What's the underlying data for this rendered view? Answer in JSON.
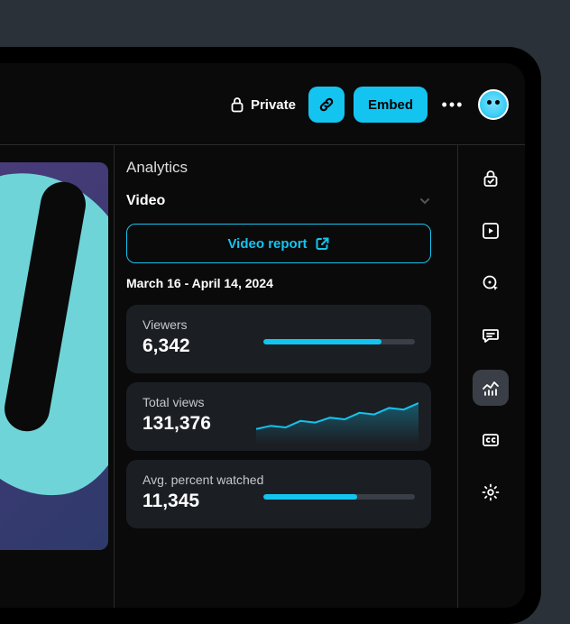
{
  "topbar": {
    "privacy_label": "Private",
    "embed_label": "Embed"
  },
  "analytics": {
    "title": "Analytics",
    "tab_label": "Video",
    "report_button": "Video report",
    "date_range": "March 16 - April 14, 2024",
    "cards": [
      {
        "label": "Viewers",
        "value": "6,342",
        "bar_pct": 78
      },
      {
        "label": "Total views",
        "value": "131,376"
      },
      {
        "label": "Avg. percent watched",
        "value": "11,345",
        "bar_pct": 62
      }
    ]
  },
  "colors": {
    "accent": "#14c4f0"
  },
  "chart_data": {
    "type": "line",
    "title": "Total views",
    "x": [
      0,
      1,
      2,
      3,
      4,
      5,
      6,
      7,
      8,
      9,
      10,
      11
    ],
    "values": [
      18,
      22,
      20,
      28,
      26,
      32,
      30,
      38,
      36,
      44,
      42,
      50
    ],
    "ylim": [
      0,
      60
    ]
  }
}
